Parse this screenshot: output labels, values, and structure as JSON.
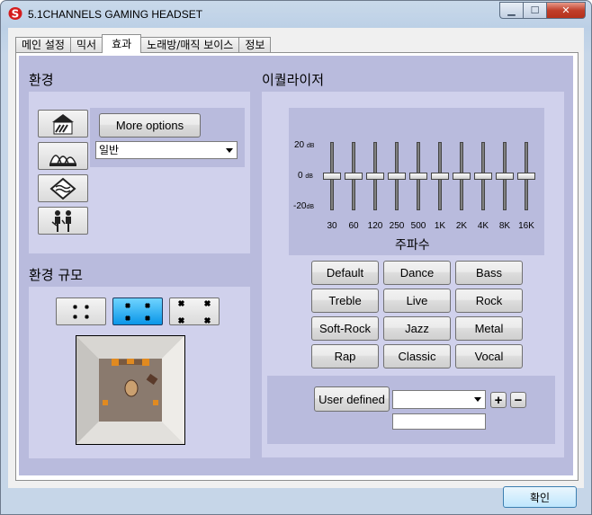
{
  "window": {
    "title": "5.1CHANNELS GAMING HEADSET"
  },
  "tabs": [
    {
      "label": "메인 설정"
    },
    {
      "label": "믹서"
    },
    {
      "label": "효과",
      "active": true
    },
    {
      "label": "노래방/매직 보이스"
    },
    {
      "label": "정보"
    }
  ],
  "environment": {
    "title": "환경",
    "more_options": "More options",
    "selected": "일반",
    "icons": [
      "hall-icon",
      "opera-house-icon",
      "underwater-icon",
      "people-icon"
    ]
  },
  "room_size": {
    "title": "환경 규모",
    "options": [
      "small-room-icon",
      "medium-room-icon",
      "large-room-icon"
    ],
    "selected_index": 1
  },
  "equalizer": {
    "title": "이퀄라이저",
    "db_labels": {
      "top": "20",
      "mid": "0",
      "bottom": "-20",
      "unit": "dB"
    },
    "bands": [
      "30",
      "60",
      "120",
      "250",
      "500",
      "1K",
      "2K",
      "4K",
      "8K",
      "16K"
    ],
    "values": [
      0,
      0,
      0,
      0,
      0,
      0,
      0,
      0,
      0,
      0
    ],
    "frequency_label": "주파수",
    "presets": [
      "Default",
      "Dance",
      "Bass",
      "Treble",
      "Live",
      "Rock",
      "Soft-Rock",
      "Jazz",
      "Metal",
      "Rap",
      "Classic",
      "Vocal"
    ],
    "user_defined_label": "User defined",
    "add_label": "+",
    "remove_label": "−",
    "preset_name_value": ""
  },
  "footer": {
    "ok_label": "확인"
  },
  "colors": {
    "panel": "#b9bbdd",
    "box": "#d0d1ec",
    "selected_room": "#1aa8f0"
  }
}
